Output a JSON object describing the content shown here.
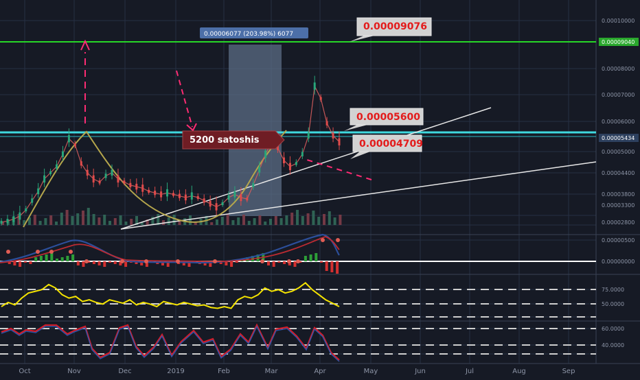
{
  "chart_data": {
    "type": "line",
    "panels": [
      {
        "name": "price",
        "y_ticks": [
          "0.00010000",
          "0.00009040",
          "0.00008000",
          "0.00007000",
          "0.00006000",
          "0.00005434",
          "0.00005000",
          "0.00004400",
          "0.00003800",
          "0.00003300",
          "0.00002800"
        ],
        "current_price": "0.00005434",
        "horizontal_level": "0.00009040",
        "range_box_label": "0.00006077 (203.98%) 6077",
        "annotations": [
          "0.00009076",
          "0.00005600",
          "0.00004709",
          "5200 satoshis"
        ],
        "series": [
          {
            "values": [
              2.8e-05,
              2.84e-05,
              2.9e-05,
              3e-05,
              3.2e-05,
              3.5e-05,
              3.8e-05,
              4.2e-05,
              4.4e-05,
              4.6e-05,
              5e-05,
              5.5e-05,
              5.3e-05,
              4.7e-05,
              4.4e-05,
              4.2e-05,
              4.1e-05,
              4.3e-05,
              4.4e-05,
              4.2e-05,
              4.1e-05,
              4e-05,
              3.95e-05,
              3.9e-05,
              3.8e-05,
              3.75e-05,
              3.7e-05,
              3.75e-05,
              3.7e-05,
              3.65e-05,
              3.6e-05,
              3.65e-05,
              3.6e-05,
              3.5e-05,
              3.4e-05,
              3.3e-05,
              3.4e-05,
              3.6e-05,
              3.7e-05,
              3.6e-05,
              3.55e-05,
              4e-05,
              4.5e-05,
              5e-05,
              5.4e-05,
              5.2e-05,
              4.8e-05,
              4.6e-05,
              4.7e-05,
              5e-05,
              5.6e-05,
              7.2e-05,
              6.8e-05,
              6e-05,
              5.6e-05,
              5.4e-05
            ]
          }
        ]
      },
      {
        "name": "macd",
        "y_ticks": [
          "0.00000500",
          "0.00000000"
        ]
      },
      {
        "name": "rsi",
        "y_ticks": [
          "75.0000",
          "50.0000"
        ],
        "values": [
          52,
          57,
          54,
          62,
          68,
          70,
          72,
          78,
          74,
          66,
          62,
          64,
          58,
          60,
          57,
          55,
          60,
          58,
          56,
          60,
          54,
          57,
          55,
          52,
          58,
          56,
          54,
          57,
          55,
          53,
          54,
          51,
          50,
          52,
          50,
          60,
          64,
          62,
          66,
          74,
          70,
          72,
          68,
          70,
          74,
          80,
          72,
          66,
          60,
          56,
          52
        ]
      },
      {
        "name": "stoch",
        "y_ticks": [
          "60.0000",
          "40.0000"
        ]
      }
    ],
    "x_ticks": [
      "Oct",
      "Nov",
      "Dec",
      "2019",
      "Feb",
      "Mar",
      "Apr",
      "May",
      "Jun",
      "Jul",
      "Aug",
      "Sep"
    ]
  }
}
